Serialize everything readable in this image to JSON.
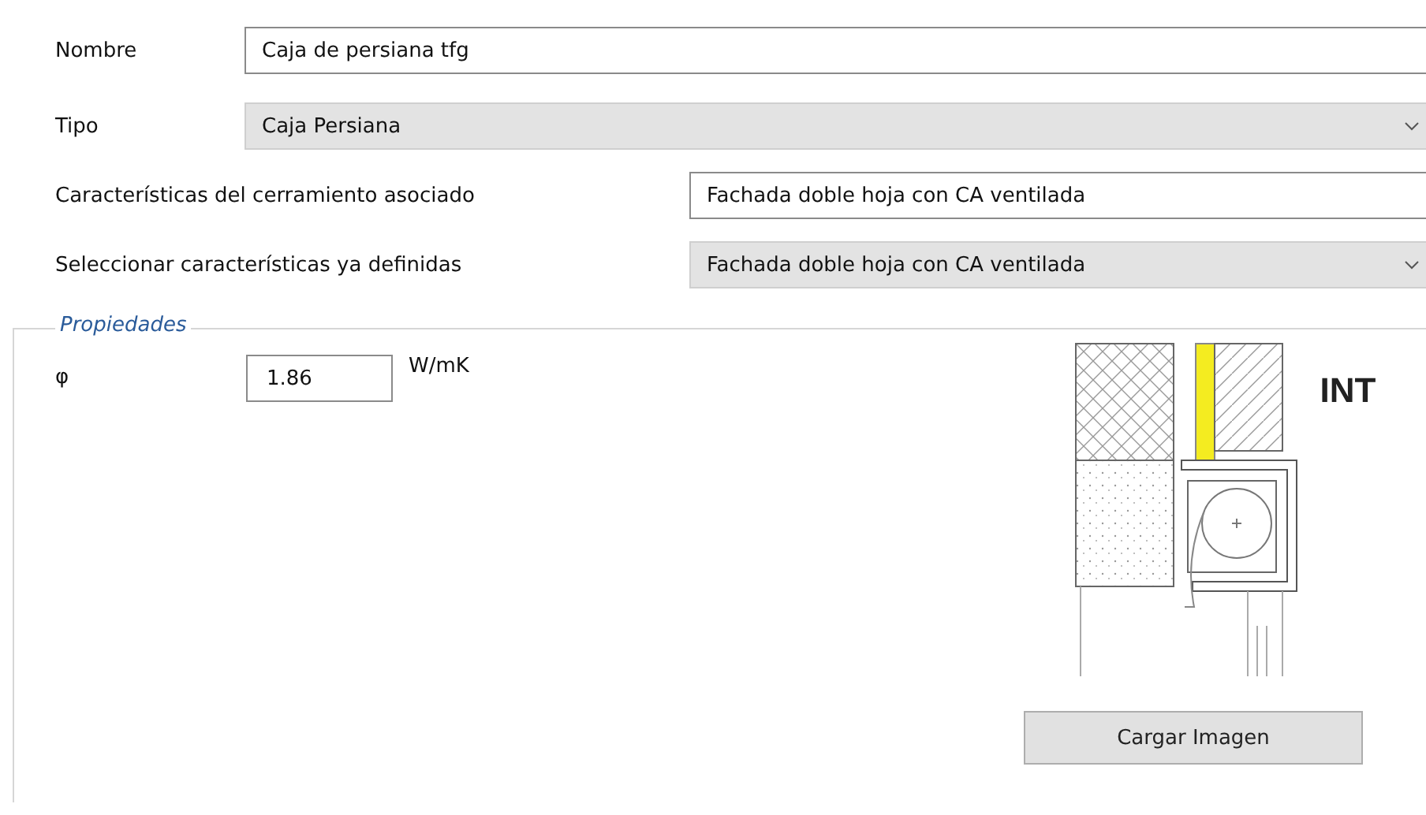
{
  "fields": [
    {
      "kind": "text",
      "label": "Nombre",
      "value": "Caja de persiana tfg"
    },
    {
      "kind": "select",
      "label": "Tipo",
      "value": "Caja Persiana"
    },
    {
      "kind": "text",
      "label": "Características del cerramiento asociado",
      "value": "Fachada doble hoja con CA ventilada"
    },
    {
      "kind": "select",
      "label": "Seleccionar características ya definidas",
      "value": "Fachada doble hoja con CA ventilada"
    }
  ],
  "properties": {
    "title": "Propiedades",
    "symbol": "φ",
    "value": "1.86",
    "unit": "W/mK",
    "image_label": "INT",
    "button": "Cargar Imagen"
  }
}
